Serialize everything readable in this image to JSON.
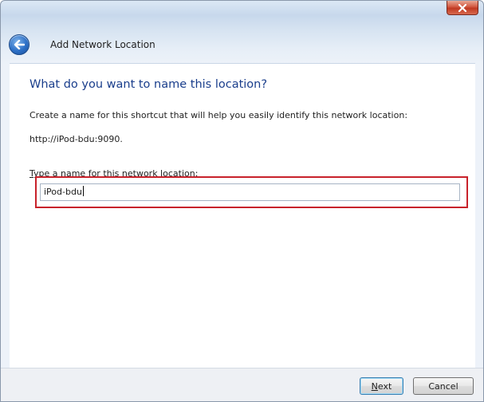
{
  "window": {
    "title": "Add Network Location",
    "close_label": "x"
  },
  "page": {
    "heading": "What do you want to name this location?",
    "description": "Create a name for this shortcut that will help you easily identify this network location:",
    "url": "http://iPod-bdu:9090.",
    "field_label_first": "T",
    "field_label_rest": "ype a name for this network location:",
    "field_value": "iPod-bdu"
  },
  "buttons": {
    "next_mnemonic": "N",
    "next_rest": "ext",
    "cancel": "Cancel"
  },
  "colors": {
    "heading": "#1a3e8c",
    "highlight_border": "#c8222b",
    "close_button": "#c8452f"
  },
  "icons": {
    "back": "back-arrow-icon",
    "close": "close-icon"
  }
}
